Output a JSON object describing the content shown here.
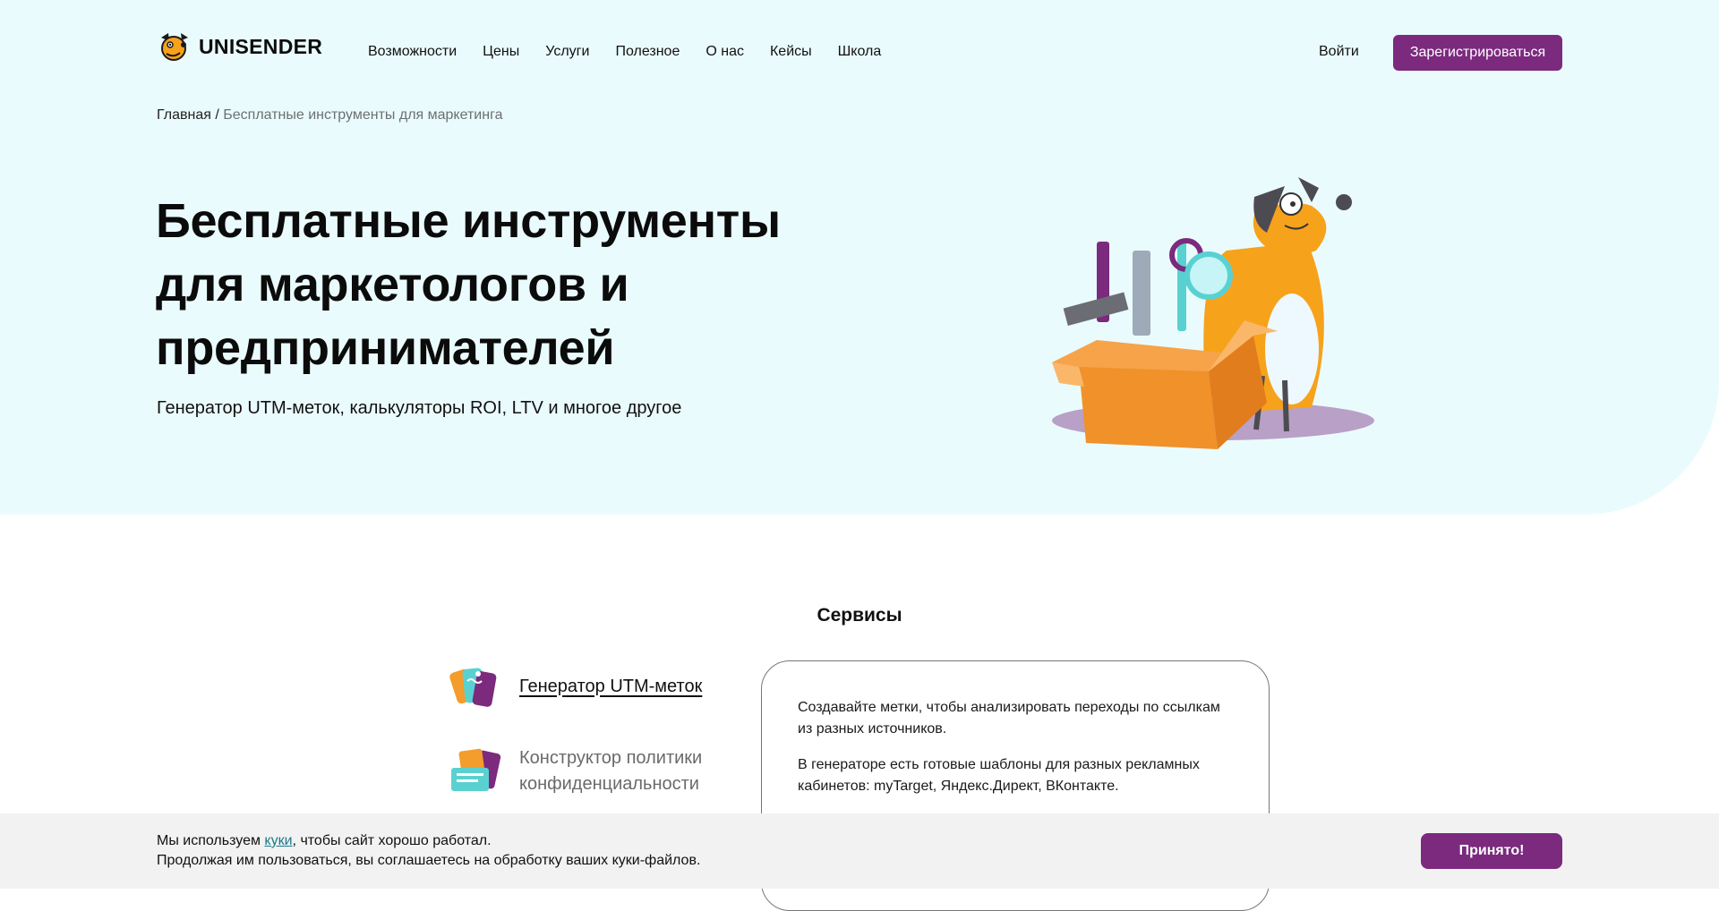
{
  "brand": {
    "name": "UNISENDER",
    "logo_icon": "dog-logo-icon",
    "accent": "#7b2a7e",
    "hero_bg": "#eafbfd"
  },
  "nav": {
    "items": [
      {
        "label": "Возможности"
      },
      {
        "label": "Цены"
      },
      {
        "label": "Услуги"
      },
      {
        "label": "Полезное"
      },
      {
        "label": "О нас"
      },
      {
        "label": "Кейсы"
      },
      {
        "label": "Школа"
      }
    ]
  },
  "auth": {
    "login_label": "Войти",
    "register_label": "Зарегистрироваться"
  },
  "breadcrumb": {
    "home": "Главная",
    "separator": " / ",
    "current": "Бесплатные инструменты для маркетинга"
  },
  "hero": {
    "title": "Бесплатные инструменты для маркетологов и предпринимателей",
    "subtitle": "Генератор UTM-меток, калькуляторы ROI, LTV и многое другое",
    "illustration": "dog-with-toolbox-illustration"
  },
  "services": {
    "title": "Сервисы",
    "items": [
      {
        "label": "Генератор UTM-меток",
        "icon": "tags-icon"
      },
      {
        "label": "Конструктор политики конфиденциальности",
        "icon": "documents-icon"
      }
    ],
    "description": [
      "Создавайте метки, чтобы анализировать переходы по ссылкам из разных источников.",
      "В генераторе есть готовые шаблоны для разных рекламных кабинетов: myTarget, Яндекс.Директ, ВКонтакте."
    ]
  },
  "cookie": {
    "prefix": "Мы используем ",
    "link": "куки",
    "suffix": ", чтобы сайт хорошо работал.",
    "line2": "Продолжая им пользоваться, вы соглашаетесь на обработку ваших куки-файлов.",
    "accept_label": "Принято!"
  }
}
